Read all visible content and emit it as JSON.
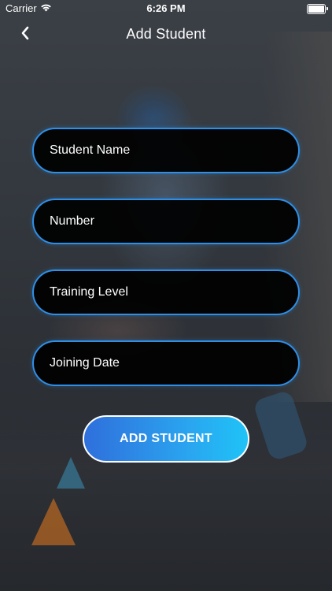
{
  "status_bar": {
    "carrier": "Carrier",
    "time": "6:26 PM",
    "icons": [
      "wifi-icon",
      "battery-icon"
    ]
  },
  "nav": {
    "title": "Add Student",
    "back_icon": "chevron-left-icon"
  },
  "form": {
    "fields": [
      {
        "placeholder": "Student Name",
        "value": ""
      },
      {
        "placeholder": "Number",
        "value": ""
      },
      {
        "placeholder": "Training Level",
        "value": ""
      },
      {
        "placeholder": "Joining Date",
        "value": ""
      }
    ],
    "submit_label": "ADD STUDENT"
  },
  "colors": {
    "field_border": "#2e8fe8",
    "field_bg": "#000000",
    "button_gradient_start": "#2f6fdc",
    "button_gradient_end": "#1fc3f7",
    "text": "#ffffff"
  }
}
